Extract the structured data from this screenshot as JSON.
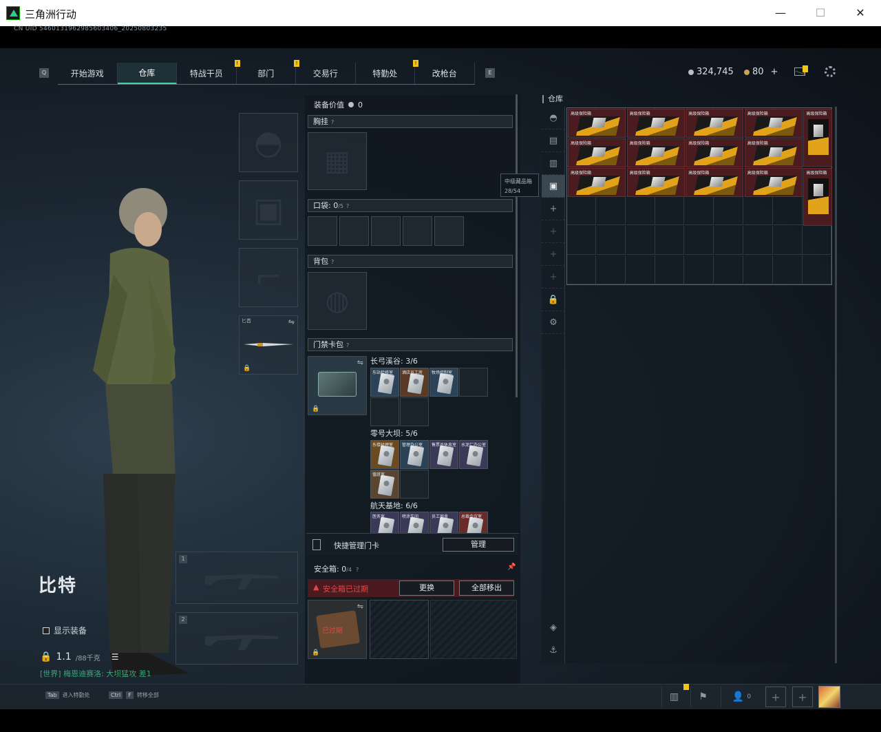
{
  "window": {
    "title": "三角洲行动",
    "minimize": "—",
    "maximize": "☐",
    "close": "✕"
  },
  "uid": "CN UID 5460131962985603406_20250803235",
  "nav": {
    "key_left": "Q",
    "key_right": "E",
    "tabs": [
      {
        "label": "开始游戏",
        "badge": false
      },
      {
        "label": "仓库",
        "badge": false,
        "active": true
      },
      {
        "label": "特战干员",
        "badge": true
      },
      {
        "label": "部门",
        "badge": true
      },
      {
        "label": "交易行",
        "badge": false
      },
      {
        "label": "特勤处",
        "badge": true
      },
      {
        "label": "改枪台",
        "badge": false
      }
    ],
    "badge_text": "!"
  },
  "currency": {
    "silver": "324,745",
    "gold": "80",
    "plus": "+"
  },
  "character": {
    "name": "比特",
    "show_gear": "显示装备",
    "weight": "1.1",
    "weight_max": "/88千克",
    "chat": "[世界] 梅恩迪赛洛: 大坝猛攻 差1"
  },
  "slots": {
    "melee_label": "匕首",
    "weapon1_num": "1",
    "weapon2_num": "2"
  },
  "gear": {
    "value_label": "装备价值",
    "value": "0",
    "chest_label": "胸挂",
    "pocket_label": "口袋:",
    "pocket_count": "0",
    "pocket_max": "/5",
    "backpack_label": "背包",
    "keycard_label": "门禁卡包",
    "help": "?"
  },
  "keycards": {
    "groups": [
      {
        "title": "长弓溪谷: 3/6",
        "cards": [
          "东站检修室",
          "酒店员工房",
          "牧场控制室"
        ]
      },
      {
        "title": "零号大坝: 5/6",
        "cards": [
          "东楼经理室",
          "管理办公室",
          "售票员休息室",
          "水泥厂办公室",
          "值班室"
        ]
      },
      {
        "title": "航天基地: 6/6",
        "cards": [
          "医务室",
          "喷涂车间",
          "员工宿舍",
          "总裁会议室"
        ]
      }
    ]
  },
  "quick_manage": {
    "label": "快捷管理门卡",
    "button": "管理"
  },
  "safe_box": {
    "label": "安全箱:",
    "count": "0",
    "max": "/4",
    "expired_warning": "安全箱已过期",
    "replace_button": "更换",
    "move_all_button": "全部移出",
    "expired_stamp": "已过期"
  },
  "tooltip": {
    "line1": "中级藏品箱",
    "line2": "28/54"
  },
  "warehouse": {
    "title": "仓库",
    "item_label": "高级保险箱",
    "tall_label": "高级保险箱"
  },
  "bottom": {
    "hotkey1_key": "Tab",
    "hotkey1_label": "进入特勤处",
    "hotkey2_key1": "Ctrl",
    "hotkey2_key2": "F",
    "hotkey2_label": "转移全部",
    "friends_count": "0",
    "plus": "+"
  }
}
